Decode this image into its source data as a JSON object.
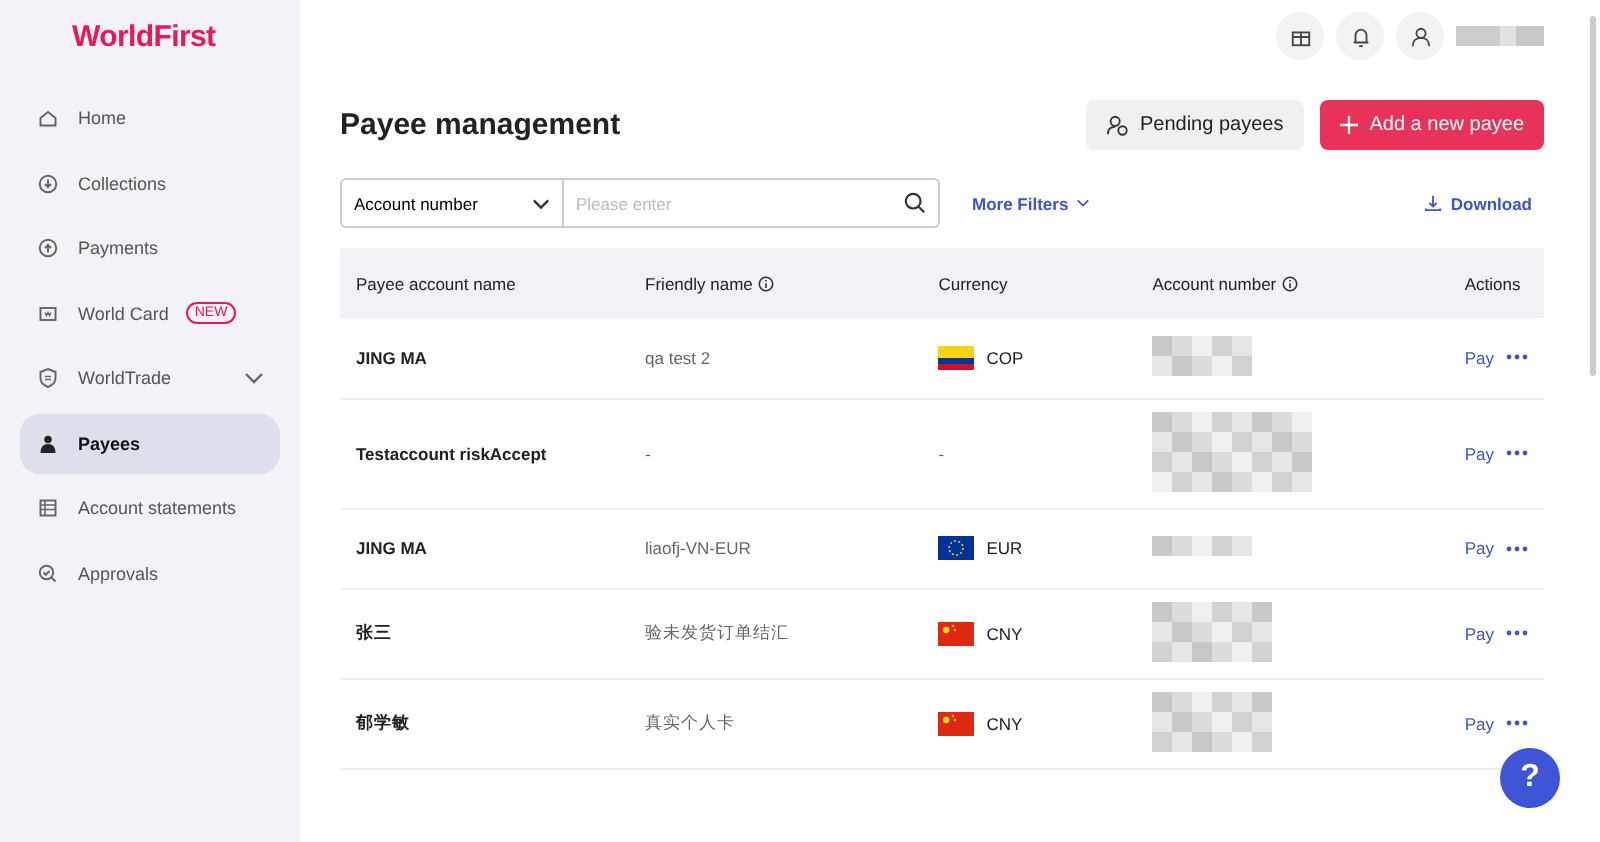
{
  "sidebar": {
    "logo": "WorldFirst",
    "items": [
      {
        "label": "Home",
        "selected": false
      },
      {
        "label": "Collections",
        "selected": false
      },
      {
        "label": "Payments",
        "selected": false
      },
      {
        "label": "World Card",
        "badge": "NEW",
        "selected": false
      },
      {
        "label": "WorldTrade",
        "expandable": true,
        "selected": false
      },
      {
        "label": "Payees",
        "selected": true
      },
      {
        "label": "Account statements",
        "selected": false
      },
      {
        "label": "Approvals",
        "selected": false
      }
    ]
  },
  "page": {
    "title": "Payee management",
    "buttons": [
      {
        "label": "Pending payees",
        "kind": "secondary"
      },
      {
        "label": "Add a new payee",
        "kind": "primary"
      }
    ]
  },
  "filters": {
    "select": "Account number",
    "search": {
      "placeholder": "Please enter"
    },
    "more": "More Filters",
    "download": "Download"
  },
  "table": {
    "columns": [
      {
        "label": "Payee account name",
        "info": false
      },
      {
        "label": "Friendly name",
        "info": true
      },
      {
        "label": "Currency",
        "info": false
      },
      {
        "label": "Account number",
        "info": true
      },
      {
        "label": "Actions",
        "info": false
      }
    ],
    "rows": [
      {
        "name": "JING MA",
        "friendly": "qa test 2",
        "currency": "COP",
        "action": "Pay"
      },
      {
        "name": "Testaccount riskAccept",
        "friendly": "-",
        "currency": "-",
        "action": "Pay"
      },
      {
        "name": "JING MA",
        "friendly": "liaofj-VN-EUR",
        "currency": "EUR",
        "action": "Pay"
      },
      {
        "name": "张三",
        "friendly": "验未发货订单结汇",
        "currency": "CNY",
        "action": "Pay"
      },
      {
        "name": "郁学敏",
        "friendly": "真实个人卡",
        "currency": "CNY",
        "action": "Pay"
      }
    ]
  },
  "help": "?"
}
